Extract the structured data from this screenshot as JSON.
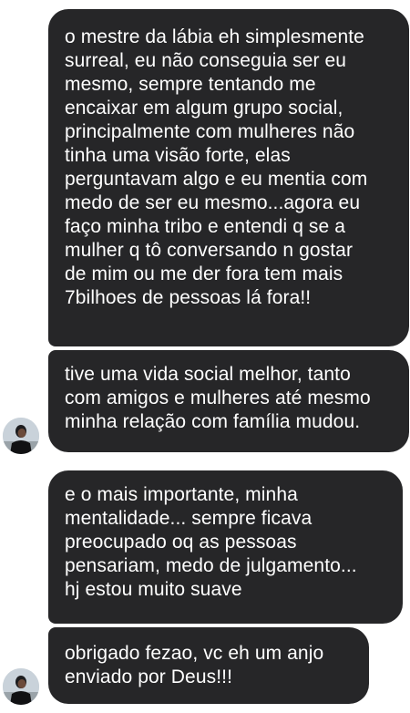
{
  "chat": {
    "messages": [
      {
        "text": "o mestre da lábia eh simplesmente\nsurreal, eu não conseguia ser eu\nmesmo, sempre tentando me\nencaixar em algum grupo social,\nprincipalmente com mulheres não\ntinha uma visão forte, elas\nperguntavam  algo e eu mentia com\nmedo de ser eu mesmo...agora eu\nfaço minha tribo e entendi q se a\nmulher q tô conversando n gostar\nde mim ou me der fora tem mais\n7bilhoes de pessoas lá fora!!"
      },
      {
        "text": "tive uma vida social melhor, tanto\ncom amigos e mulheres até mesmo\nminha relação com família mudou."
      },
      {
        "text": "e o mais importante, minha\nmentalidade... sempre ficava\npreocupado oq as pessoas\npensariam, medo de julgamento...\nhj estou muito suave"
      },
      {
        "text": "obrigado fezao, vc eh um anjo\nenviado por Deus!!!"
      }
    ],
    "avatar_icon": "user-photo-avatar",
    "bubble_color": "#262628",
    "text_color": "#ffffff",
    "background_color": "#ffffff"
  }
}
